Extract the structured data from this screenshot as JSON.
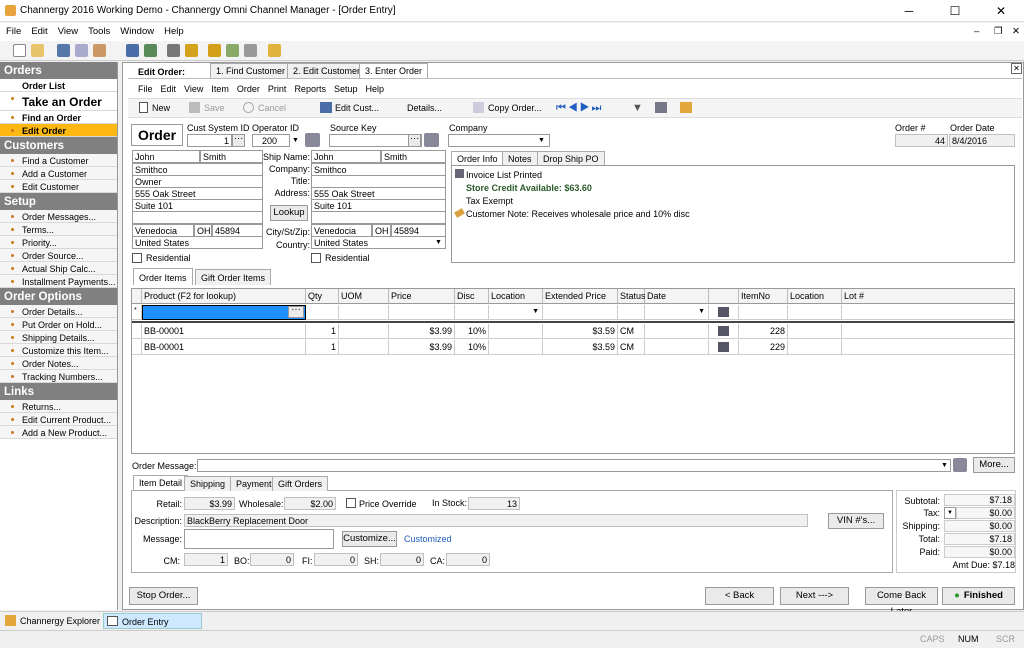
{
  "window": {
    "title": "Channergy 2016 Working Demo - Channergy Omni Channel Manager - [Order Entry]",
    "min": "─",
    "max": "☐",
    "close": "✕",
    "mdi_min": "–",
    "mdi_restore": "❐",
    "mdi_close": "✕"
  },
  "menu": [
    "File",
    "Edit",
    "View",
    "Tools",
    "Window",
    "Help"
  ],
  "sidebar": {
    "orders_title": "Orders",
    "orders": [
      "Order List",
      "Take an Order",
      "Find an Order",
      "Edit Order"
    ],
    "customers_title": "Customers",
    "customers": [
      "Find a Customer",
      "Add a Customer",
      "Edit Customer"
    ],
    "setup_title": "Setup",
    "setup": [
      "Order Messages...",
      "Terms...",
      "Priority...",
      "Order Source...",
      "Actual Ship Calc...",
      "Installment Payments..."
    ],
    "options_title": "Order Options",
    "options": [
      "Order Details...",
      "Put Order on Hold...",
      "Shipping Details...",
      "Customize this Item...",
      "Order Notes...",
      "Tracking Numbers..."
    ],
    "links_title": "Links",
    "links": [
      "Returns...",
      "Edit Current Product...",
      "Add a New Product..."
    ]
  },
  "wizard": {
    "label": "Edit Order:",
    "tabs": [
      "1. Find Customer",
      "2. Edit Customer",
      "3. Enter Order"
    ],
    "close": "✕"
  },
  "inner_menu": [
    "File",
    "Edit",
    "View",
    "Item",
    "Order",
    "Print",
    "Reports",
    "Setup",
    "Help"
  ],
  "inner_toolbar": {
    "new": "New",
    "save": "Save",
    "cancel": "Cancel",
    "edit_cust": "Edit Cust...",
    "details": "Details...",
    "copy_order": "Copy Order..."
  },
  "header": {
    "title": "Order",
    "cust_system_id_label": "Cust System ID",
    "cust_system_id": "1",
    "operator_id_label": "Operator ID",
    "operator_id": "200",
    "source_key_label": "Source Key",
    "source_key": "",
    "company_label": "Company",
    "company": "",
    "order_num_label": "Order #",
    "order_num": "44",
    "order_date_label": "Order Date",
    "order_date": "8/4/2016"
  },
  "bill_to": {
    "first": "John",
    "last": "Smith",
    "company": "Smithco",
    "title": "Owner",
    "address1": "555 Oak Street",
    "address2": "Suite 101",
    "city": "Venedocia",
    "state": "OH",
    "zip": "45894",
    "country": "United States",
    "residential": "Residential"
  },
  "ship_to": {
    "name_label": "Ship Name:",
    "company_label": "Company:",
    "title_label": "Title:",
    "address_label": "Address:",
    "city_label": "City/St/Zip:",
    "country_label": "Country:",
    "lookup": "Lookup",
    "first": "John",
    "last": "Smith",
    "company": "Smithco",
    "title": "",
    "address1": "555 Oak Street",
    "address2": "Suite 101",
    "city": "Venedocia",
    "state": "OH",
    "zip": "45894",
    "country": "United States",
    "residential": "Residential"
  },
  "info_tabs": [
    "Order Info",
    "Notes",
    "Drop Ship PO"
  ],
  "info": {
    "line1": "Invoice List Printed",
    "line2": "Store Credit Available: $63.60",
    "line3": "Tax Exempt",
    "line4": "Customer Note: Receives wholesale price and 10% disc"
  },
  "item_tabs": [
    "Order Items",
    "Gift Order Items"
  ],
  "grid": {
    "columns": [
      "Product  (F2 for lookup)",
      "Qty",
      "UOM",
      "Price",
      "Disc",
      "Location",
      "Extended Price",
      "Status",
      "Date",
      "",
      "ItemNo",
      "Location",
      "Lot #"
    ],
    "new_row_ellipsis": "···",
    "rows": [
      {
        "product": "BB-00001",
        "qty": "1",
        "uom": "",
        "price": "$3.99",
        "disc": "10%",
        "location": "",
        "ext": "$3.59",
        "status": "CM",
        "date": "",
        "itemno": "228",
        "location2": "",
        "lot": ""
      },
      {
        "product": "BB-00001",
        "qty": "1",
        "uom": "",
        "price": "$3.99",
        "disc": "10%",
        "location": "",
        "ext": "$3.59",
        "status": "CM",
        "date": "",
        "itemno": "229",
        "location2": "",
        "lot": ""
      }
    ]
  },
  "order_message": {
    "label": "Order Message:",
    "value": "",
    "more": "More..."
  },
  "detail_tabs": [
    "Item Detail",
    "Shipping",
    "Payment",
    "Gift Orders"
  ],
  "detail": {
    "retail_label": "Retail:",
    "retail": "$3.99",
    "wholesale_label": "Wholesale:",
    "wholesale": "$2.00",
    "price_override": "Price Override",
    "in_stock_label": "In Stock:",
    "in_stock": "13",
    "description_label": "Description:",
    "description": "BlackBerry Replacement Door",
    "vin": "VIN #'s...",
    "message_label": "Message:",
    "message": "",
    "customize": "Customize...",
    "customized": "Customized",
    "cm_label": "CM:",
    "cm": "1",
    "bo_label": "BO:",
    "bo": "0",
    "fi_label": "FI:",
    "fi": "0",
    "sh_label": "SH:",
    "sh": "0",
    "ca_label": "CA:",
    "ca": "0"
  },
  "totals": {
    "subtotal_label": "Subtotal:",
    "subtotal": "$7.18",
    "tax_label": "Tax:",
    "tax": "$0.00",
    "shipping_label": "Shipping:",
    "shipping": "$0.00",
    "total_label": "Total:",
    "total": "$7.18",
    "paid_label": "Paid:",
    "paid": "$0.00",
    "amt_due_label": "Amt Due:",
    "amt_due": "$7.18"
  },
  "actions": {
    "stop_order": "Stop Order...",
    "back": "< Back",
    "next": "Next --->",
    "come_back_later": "Come Back Later",
    "finished": "Finished"
  },
  "taskbar": [
    "Channergy Explorer",
    "Order Entry"
  ],
  "status": [
    "CAPS",
    "NUM",
    "SCR"
  ],
  "colors": {
    "accent": "#fdb813",
    "section_header": "#808080",
    "link_blue": "#1f5fbf"
  }
}
